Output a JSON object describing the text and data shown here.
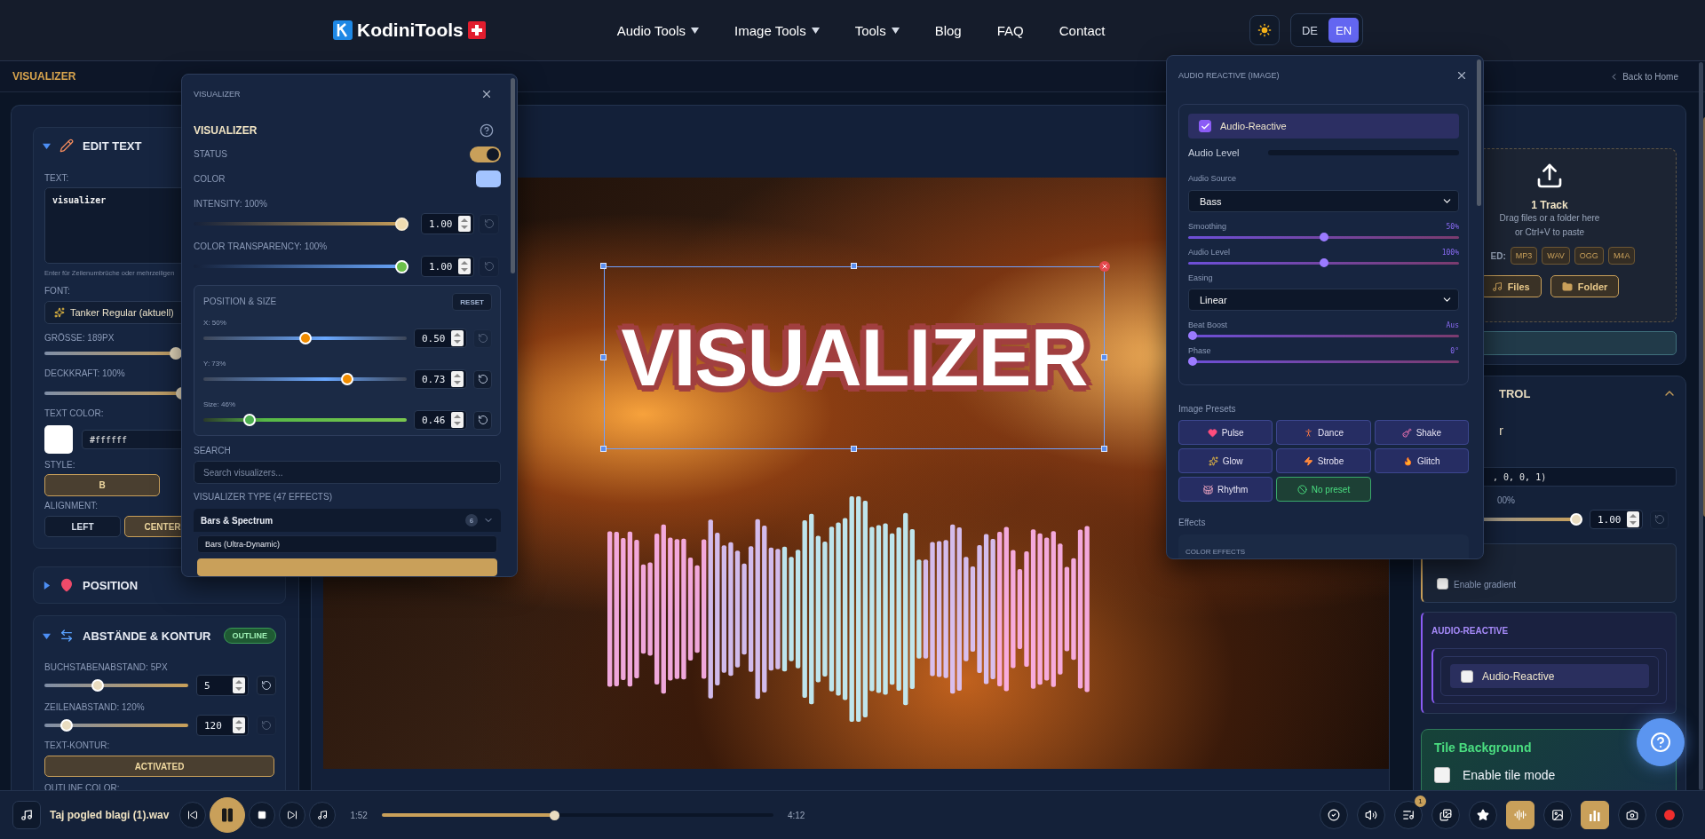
{
  "header": {
    "brand": "KodiniTools",
    "nav": [
      {
        "label": "Audio Tools",
        "dropdown": true
      },
      {
        "label": "Image Tools",
        "dropdown": true
      },
      {
        "label": "Tools",
        "dropdown": true
      },
      {
        "label": "Blog",
        "dropdown": false
      },
      {
        "label": "FAQ",
        "dropdown": false
      },
      {
        "label": "Contact",
        "dropdown": false
      }
    ],
    "languages": [
      {
        "label": "DE",
        "selected": false
      },
      {
        "label": "EN",
        "selected": true
      }
    ]
  },
  "subheader": {
    "title": "VISUALIZER",
    "back_link": "Back to Home"
  },
  "left_panel": {
    "sections": [
      {
        "kind": "edit_text",
        "title": "EDIT TEXT",
        "expanded": true,
        "text_label": "TEXT:",
        "text_value": "visualizer",
        "hint": "Enter für Zeilenumbrüche oder mehrzeiligen",
        "font_label": "FONT:",
        "font_value": "Tanker Regular (aktuell)",
        "size_label": "GRÖSSE: 189PX",
        "size": {
          "level": 0.95
        },
        "opacity_label": "DECKKRAFT: 100%",
        "opacity": {
          "level": 1
        },
        "color_label": "TEXT COLOR:",
        "color_value": "#ffffff",
        "style_label": "STYLE:",
        "styles": [
          {
            "label": "B",
            "selected": true
          }
        ],
        "alignment_label": "ALIGNMENT:",
        "alignments": [
          {
            "label": "LEFT",
            "selected": false
          },
          {
            "label": "CENTER",
            "selected": true
          }
        ]
      },
      {
        "kind": "position",
        "title": "POSITION",
        "expanded": false
      },
      {
        "kind": "spacing",
        "title": "ABSTÄNDE & KONTUR",
        "expanded": true,
        "badge": "OUTLINE",
        "rows": [
          {
            "label": "BUCHSTABENABSTAND: 5PX",
            "level": 0.36,
            "value": "5",
            "reset_enabled": true
          },
          {
            "label": "ZEILENABSTAND: 120%",
            "level": 0.12,
            "value": "120",
            "reset_enabled": false
          }
        ],
        "outline_label": "TEXT-KONTUR:",
        "outline_button": {
          "label": "ACTIVATED",
          "selected": true
        },
        "outline_color_label": "OUTLINE COLOR:"
      }
    ]
  },
  "canvas": {
    "overlay_text": "VISUALIZER"
  },
  "visualizer_window": {
    "title": "VISUALIZER",
    "heading": "VISUALIZER",
    "status_label": "STATUS",
    "status_on": true,
    "color_label": "COLOR",
    "sliders": [
      {
        "label": "INTENSITY: 100%",
        "kind": "gold",
        "level": 1,
        "value": "1.00",
        "reset_enabled": false
      },
      {
        "label": "COLOR TRANSPARENCY: 100%",
        "kind": "fade",
        "level": 1,
        "value": "1.00",
        "reset_enabled": false
      }
    ],
    "position": {
      "title": "POSITION & SIZE",
      "reset": "RESET",
      "sliders": [
        {
          "label": "X: 50%",
          "kind": "axis",
          "level": 0.5,
          "value": "0.50",
          "reset_enabled": false
        },
        {
          "label": "Y: 73%",
          "kind": "axis",
          "level": 0.72,
          "value": "0.73",
          "reset_enabled": true
        },
        {
          "label": "Size: 46%",
          "kind": "size",
          "level": 0.21,
          "value": "0.46",
          "reset_enabled": true
        }
      ]
    },
    "search_label": "SEARCH",
    "search_placeholder": "Search visualizers...",
    "type_label": "VISUALIZER TYPE (47 EFFECTS)",
    "category": {
      "label": "Bars & Spectrum",
      "count": "6",
      "expanded": true,
      "items": [
        {
          "label": "Bars (Ultra-Dynamic)",
          "selected": false
        },
        {
          "selected": true
        }
      ]
    }
  },
  "audio_window": {
    "title": "AUDIO REACTIVE (IMAGE)",
    "toggle": {
      "label": "Audio-Reactive",
      "checked": true
    },
    "meter_label": "Audio Level",
    "meter": {
      "level": 0
    },
    "controls": [
      {
        "kind": "select",
        "label": "Audio Source",
        "value": "Bass"
      },
      {
        "kind": "slider",
        "label": "Smoothing",
        "reading": "50%",
        "level": 0.5
      },
      {
        "kind": "slider",
        "label": "Audio Level",
        "reading": "100%",
        "level": 0.5
      },
      {
        "kind": "select",
        "label": "Easing",
        "value": "Linear"
      },
      {
        "kind": "slider",
        "label": "Beat Boost",
        "reading": "Aus",
        "level": 0
      },
      {
        "kind": "slider",
        "label": "Phase",
        "reading": "0°",
        "level": 0
      }
    ],
    "presets_label": "Image Presets",
    "presets": [
      {
        "label": "Pulse",
        "selected": false
      },
      {
        "label": "Dance",
        "selected": false
      },
      {
        "label": "Shake",
        "selected": false
      },
      {
        "label": "Glow",
        "selected": false
      },
      {
        "label": "Strobe",
        "selected": false
      },
      {
        "label": "Glitch",
        "selected": false
      },
      {
        "label": "Rhythm",
        "selected": false
      },
      {
        "label": "No preset",
        "selected": true
      }
    ],
    "effects_label": "Effects",
    "effects_group": "COLOR EFFECTS"
  },
  "right_panel": {
    "upload": {
      "title": "1 Track",
      "hint": "Drag files or a folder here",
      "hint_2": "or Ctrl+V to paste",
      "formats_label": "ED:",
      "formats": [
        "MP3",
        "WAV",
        "OGG",
        "M4A"
      ],
      "buttons": [
        "Files",
        "Folder"
      ]
    },
    "control": {
      "title": "TROL",
      "expanded": true,
      "label_fragment": "r",
      "color_value": ", 0, 0, 1)",
      "opacity_label": "00%",
      "opacity": {
        "level": 1,
        "value": "1.00"
      },
      "gradient": {
        "label": "Enable gradient",
        "checked": false
      }
    },
    "audio_reactive": {
      "title": "AUDIO-REACTIVE",
      "toggle": {
        "label": "Audio-Reactive",
        "checked": false
      }
    },
    "tile": {
      "title": "Tile Background",
      "toggle": {
        "label": "Enable tile mode",
        "checked": false
      }
    }
  },
  "player": {
    "file": "Taj pogled blagi (1).wav",
    "playing": true,
    "elapsed": "1:52",
    "duration": "4:12",
    "progress": {
      "level": 0.44
    },
    "tools": [
      {
        "kind": "check",
        "selected": false
      },
      {
        "kind": "volume",
        "selected": false
      },
      {
        "kind": "playlist",
        "selected": false,
        "badge": "1"
      },
      {
        "kind": "gallery",
        "selected": false
      },
      {
        "kind": "star",
        "selected": false
      },
      {
        "kind": "waveform",
        "selected": true
      },
      {
        "kind": "image",
        "selected": false
      },
      {
        "kind": "bars",
        "selected": true
      },
      {
        "kind": "camera",
        "selected": false
      },
      {
        "kind": "record",
        "selected": false
      }
    ]
  }
}
